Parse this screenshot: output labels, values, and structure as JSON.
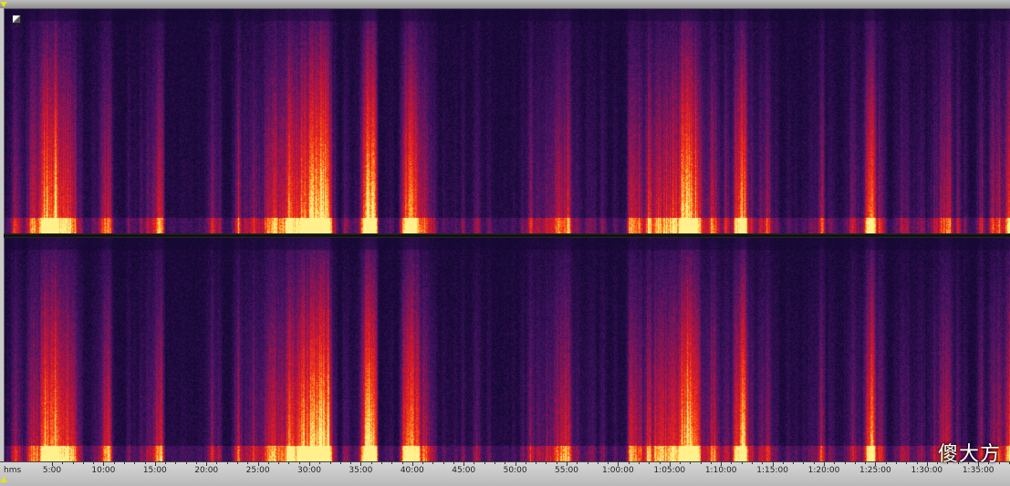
{
  "spectrogram": {
    "channels": [
      "left",
      "right"
    ],
    "colors": {
      "background": "#1b0a3a",
      "low": "#3a1460",
      "mid": "#c0163a",
      "high": "#ff3a10",
      "peak": "#ffe070"
    }
  },
  "ruler": {
    "unit": "hms",
    "labels": [
      "5:00",
      "10:00",
      "15:00",
      "20:00",
      "25:00",
      "30:00",
      "35:00",
      "40:00",
      "45:00",
      "50:00",
      "55:00",
      "1:00:00",
      "1:05:00",
      "1:10:00",
      "1:15:00",
      "1:20:00",
      "1:25:00",
      "1:30:00",
      "1:35:00"
    ]
  },
  "watermark": "傻大方",
  "icons": {
    "zoom_toggle": "zoom-toggle-icon",
    "play_marker_start": "playhead-start-icon",
    "play_marker_end": "playhead-end-icon"
  }
}
